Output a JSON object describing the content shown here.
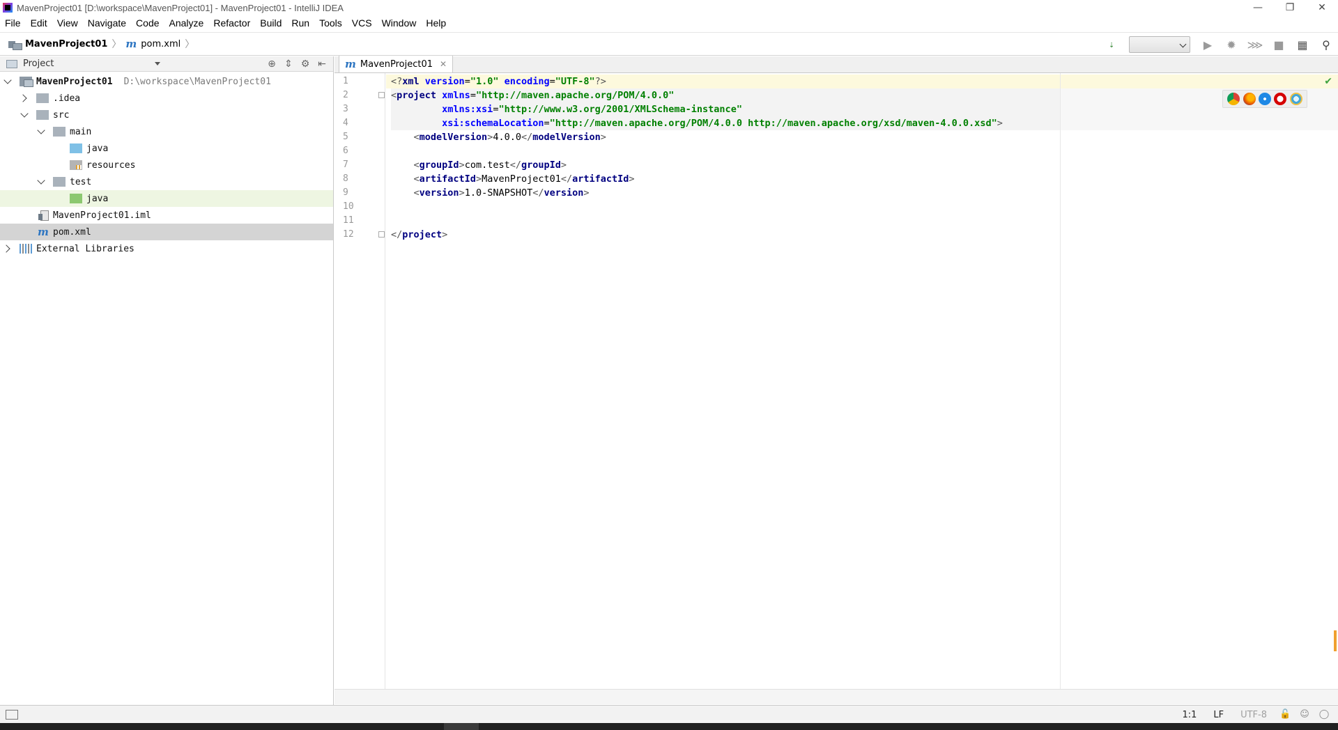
{
  "window": {
    "title": "MavenProject01 [D:\\workspace\\MavenProject01] - MavenProject01 - IntelliJ IDEA",
    "controls": [
      "—",
      "❐",
      "✕"
    ]
  },
  "menu": [
    "File",
    "Edit",
    "View",
    "Navigate",
    "Code",
    "Analyze",
    "Refactor",
    "Build",
    "Run",
    "Tools",
    "VCS",
    "Window",
    "Help"
  ],
  "breadcrumb": {
    "project": "MavenProject01",
    "file": "pom.xml"
  },
  "project_panel": {
    "title": "Project",
    "tree": [
      {
        "label": "MavenProject01",
        "path": "D:\\workspace\\MavenProject01",
        "icon": "module-folder-icon",
        "state": "expanded"
      },
      {
        "label": ".idea",
        "icon": "folder-icon",
        "state": "collapsed"
      },
      {
        "label": "src",
        "icon": "folder-icon",
        "state": "expanded"
      },
      {
        "label": "main",
        "icon": "folder-icon",
        "state": "expanded"
      },
      {
        "label": "java",
        "icon": "source-folder-icon",
        "state": "leaf"
      },
      {
        "label": "resources",
        "icon": "resources-folder-icon",
        "state": "leaf"
      },
      {
        "label": "test",
        "icon": "folder-icon",
        "state": "expanded"
      },
      {
        "label": "java",
        "icon": "test-folder-icon",
        "state": "leaf"
      },
      {
        "label": "MavenProject01.iml",
        "icon": "iml-file-icon",
        "state": "leaf"
      },
      {
        "label": "pom.xml",
        "icon": "maven-file-icon",
        "state": "leaf"
      },
      {
        "label": "External Libraries",
        "icon": "libraries-icon",
        "state": "collapsed"
      }
    ]
  },
  "editor": {
    "tab_label": "MavenProject01",
    "line_numbers": [
      "1",
      "2",
      "3",
      "4",
      "5",
      "6",
      "7",
      "8",
      "9",
      "10",
      "11",
      "12"
    ],
    "lines": {
      "l1_open": "<?",
      "l1_tag": "xml",
      "l1_a1": " version",
      "l1_eq1": "=",
      "l1_v1": "\"1.0\"",
      "l1_a2": " encoding",
      "l1_eq2": "=",
      "l1_v2": "\"UTF-8\"",
      "l1_close": "?>",
      "l2_open": "<",
      "l2_tag": "project",
      "l2_a": " xmlns",
      "l2_eq": "=",
      "l2_v": "\"http://maven.apache.org/POM/4.0.0\"",
      "l3_indent": "         ",
      "l3_a": "xmlns:xsi",
      "l3_eq": "=",
      "l3_v": "\"http://www.w3.org/2001/XMLSchema-instance\"",
      "l4_indent": "         ",
      "l4_a": "xsi:schemaLocation",
      "l4_eq": "=",
      "l4_v": "\"http://maven.apache.org/POM/4.0.0 http://maven.apache.org/xsd/maven-4.0.0.xsd\"",
      "l4_close": ">",
      "l5_indent": "    ",
      "l5_open": "<",
      "l5_tag": "modelVersion",
      "l5_gt": ">",
      "l5_text": "4.0.0",
      "l5_close_open": "</",
      "l5_close_tag": "modelVersion",
      "l5_close_gt": ">",
      "l7_indent": "    ",
      "l7_open": "<",
      "l7_tag": "groupId",
      "l7_gt": ">",
      "l7_text": "com.test",
      "l7_close_open": "</",
      "l7_close_tag": "groupId",
      "l7_close_gt": ">",
      "l8_indent": "    ",
      "l8_open": "<",
      "l8_tag": "artifactId",
      "l8_gt": ">",
      "l8_text": "MavenProject01",
      "l8_close_open": "</",
      "l8_close_tag": "artifactId",
      "l8_close_gt": ">",
      "l9_indent": "    ",
      "l9_open": "<",
      "l9_tag": "version",
      "l9_gt": ">",
      "l9_text": "1.0-SNAPSHOT",
      "l9_close_open": "</",
      "l9_close_tag": "version",
      "l9_close_gt": ">",
      "l12_open": "</",
      "l12_tag": "project",
      "l12_gt": ">"
    },
    "browser_icons": [
      "chrome-icon",
      "firefox-icon",
      "safari-icon",
      "opera-icon",
      "ie-icon"
    ],
    "colors": {
      "tag": "#000080",
      "attribute": "#0000ff",
      "value": "#008000",
      "current_line": "#fdf9dd"
    }
  },
  "status": {
    "position": "1:1",
    "line_separator": "LF",
    "encoding": "UTF-8"
  }
}
